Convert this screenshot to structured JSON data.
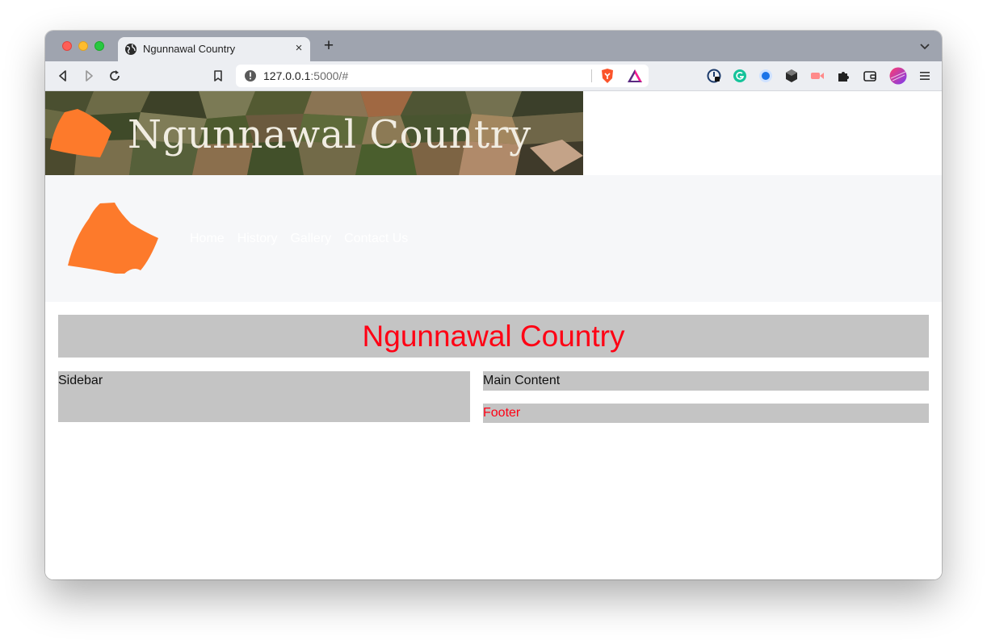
{
  "browser": {
    "tab_title": "Ngunnawal Country",
    "url_host": "127.0.0.1",
    "url_rest": ":5000/#",
    "new_tab_symbol": "+",
    "close_symbol": "×"
  },
  "site": {
    "banner_title": "Ngunnawal Country",
    "nav": {
      "items": [
        {
          "label": "Home"
        },
        {
          "label": "History"
        },
        {
          "label": "Gallery"
        },
        {
          "label": "Contact Us"
        }
      ]
    },
    "headline": "Ngunnawal Country",
    "sidebar_text": "Sidebar",
    "main_text": "Main Content",
    "footer_text": "Footer"
  },
  "colors": {
    "accent_red": "#ff0014",
    "logo_orange": "#fd7a2b",
    "block_gray": "#c4c4c4",
    "navbar_bg": "#f6f7f9"
  },
  "icons": [
    "globe-icon",
    "back-icon",
    "forward-icon",
    "reload-icon",
    "bookmark-icon",
    "info-icon",
    "brave-shield-icon",
    "brave-rewards-icon",
    "password-manager-icon",
    "grammarly-icon",
    "blue-dot-extension-icon",
    "cube-extension-icon",
    "video-extension-icon",
    "extensions-puzzle-icon",
    "wallet-icon",
    "profile-avatar-icon",
    "menu-icon",
    "tab-list-icon"
  ]
}
